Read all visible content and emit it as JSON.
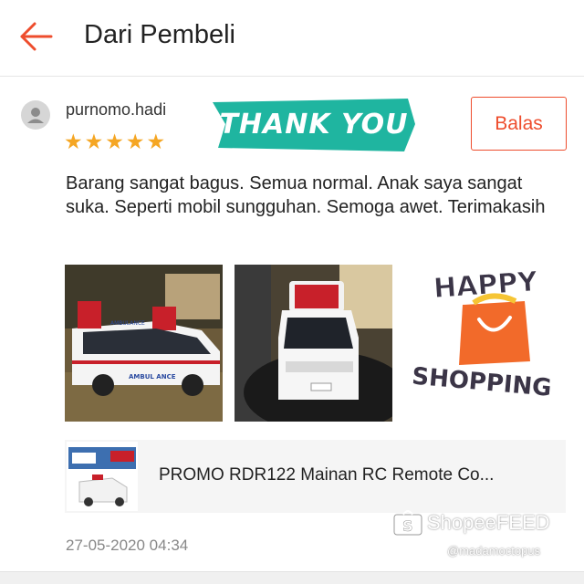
{
  "header": {
    "title": "Dari Pembeli",
    "back_icon": "arrow-left-icon",
    "accent_color": "#ee4d2d"
  },
  "review": {
    "username": "purnomo.hadi",
    "rating": 5,
    "stars": "★★★★★",
    "sticker_thank_you": "THANK YOU",
    "reply_label": "Balas",
    "comment": "Barang sangat bagus. Semua normal. Anak saya sangat suka. Seperti mobil sungguhan. Semoga awet. Terimakasih",
    "photo_labels": {
      "photo1": "AMBULANCE",
      "photo1_side": "AMBUL ANCE"
    },
    "sticker_happy": "HAPPY",
    "sticker_shopping": "SHOPPING",
    "product_name": "PROMO RDR122 Mainan RC Remote Co...",
    "timestamp": "27-05-2020 04:34"
  },
  "watermark": {
    "brand": "ShopeeFEED",
    "handle": "@madamoctopus"
  },
  "colors": {
    "star": "#f5a623",
    "thank_you_banner": "#1fb5a0",
    "bag": "#f26a2a"
  }
}
